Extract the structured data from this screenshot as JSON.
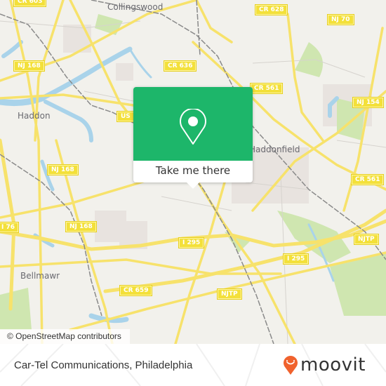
{
  "map": {
    "places": [
      "Collingswood",
      "Haddon",
      "Haddonfield",
      "Bellmawr"
    ],
    "road_shields": [
      "CR 603",
      "CR 628",
      "NJ 70",
      "NJ 168",
      "CR 636",
      "CR 561",
      "US",
      "NJ 154",
      "NJ 168",
      "CR 561",
      "I 76",
      "NJ 168",
      "I 295",
      "NJTP",
      "I 295",
      "CR 659",
      "NJTP"
    ],
    "attribution": "© OpenStreetMap contributors",
    "colors": {
      "land": "#f2f1ec",
      "water": "#a9d3ea",
      "park": "#cfe6b0",
      "road": "#f7e26b",
      "rail": "#8a8a8a"
    }
  },
  "popup": {
    "icon": "location-pin-icon",
    "button_label": "Take me there",
    "color": "#1db66a"
  },
  "footer": {
    "title": "Car-Tel Communications, Philadelphia",
    "brand": "moovit",
    "brand_color": "#f0622d"
  }
}
